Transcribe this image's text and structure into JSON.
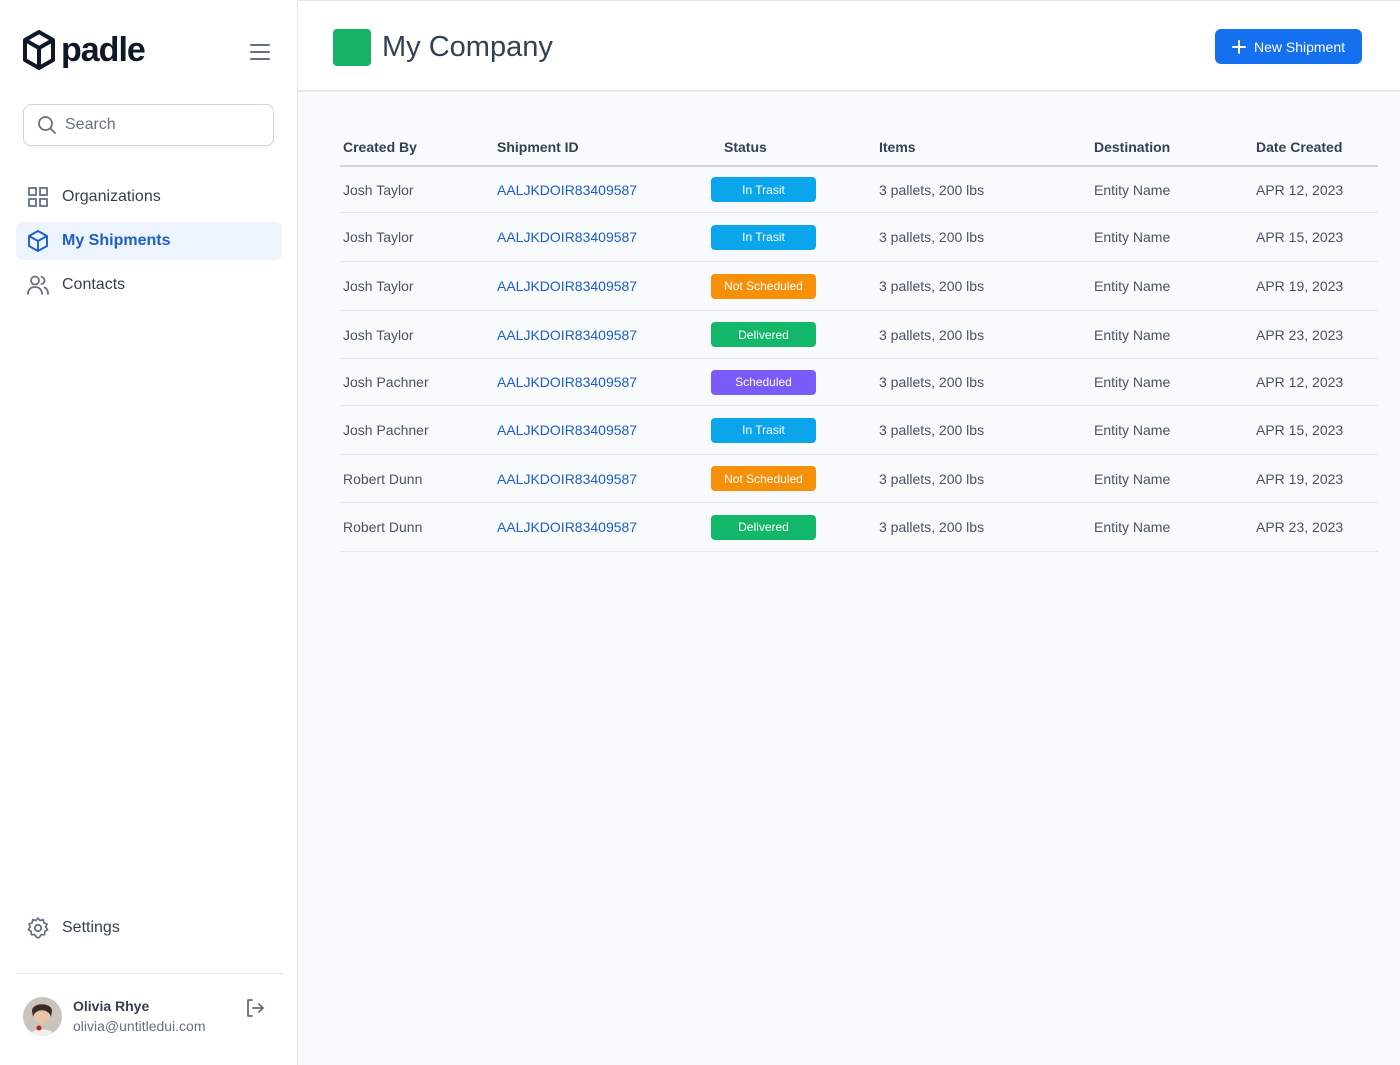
{
  "app": {
    "logo_text": "padle",
    "search_placeholder": "Search"
  },
  "sidebar": {
    "items": [
      {
        "label": "Organizations",
        "icon": "grid-icon",
        "active": false
      },
      {
        "label": "My Shipments",
        "icon": "cube-icon",
        "active": true
      },
      {
        "label": "Contacts",
        "icon": "users-icon",
        "active": false
      }
    ],
    "settings_label": "Settings"
  },
  "user": {
    "name": "Olivia Rhye",
    "email": "olivia@untitledui.com"
  },
  "header": {
    "title": "My Company",
    "new_button_label": "New Shipment"
  },
  "table": {
    "columns": [
      "Created By",
      "Shipment ID",
      "Status",
      "Items",
      "Destination",
      "Date Created"
    ],
    "rows": [
      {
        "created_by": "Josh Taylor",
        "shipment_id": "AALJKDOIR83409587",
        "status": "In Trasit",
        "items": "3 pallets, 200 lbs",
        "destination": "Entity Name",
        "date": "APR 12, 2023"
      },
      {
        "created_by": "Josh Taylor",
        "shipment_id": "AALJKDOIR83409587",
        "status": "In Trasit",
        "items": "3 pallets, 200 lbs",
        "destination": "Entity Name",
        "date": "APR 15, 2023"
      },
      {
        "created_by": "Josh Taylor",
        "shipment_id": "AALJKDOIR83409587",
        "status": "Not Scheduled",
        "items": "3 pallets, 200 lbs",
        "destination": "Entity Name",
        "date": "APR 19, 2023"
      },
      {
        "created_by": "Josh Taylor",
        "shipment_id": "AALJKDOIR83409587",
        "status": "Delivered",
        "items": "3 pallets, 200 lbs",
        "destination": "Entity Name",
        "date": "APR 23, 2023"
      },
      {
        "created_by": "Josh Pachner",
        "shipment_id": "AALJKDOIR83409587",
        "status": "Scheduled",
        "items": "3 pallets, 200 lbs",
        "destination": "Entity Name",
        "date": "APR 12, 2023"
      },
      {
        "created_by": "Josh Pachner",
        "shipment_id": "AALJKDOIR83409587",
        "status": "In Trasit",
        "items": "3 pallets, 200 lbs",
        "destination": "Entity Name",
        "date": "APR 15, 2023"
      },
      {
        "created_by": "Robert Dunn",
        "shipment_id": "AALJKDOIR83409587",
        "status": "Not Scheduled",
        "items": "3 pallets, 200 lbs",
        "destination": "Entity Name",
        "date": "APR 19, 2023"
      },
      {
        "created_by": "Robert Dunn",
        "shipment_id": "AALJKDOIR83409587",
        "status": "Delivered",
        "items": "3 pallets, 200 lbs",
        "destination": "Entity Name",
        "date": "APR 23, 2023"
      }
    ]
  },
  "colors": {
    "brand": "#1570ef",
    "company": "#16b364",
    "status": {
      "In Trasit": "#0ba5ec",
      "Not Scheduled": "#f79009",
      "Delivered": "#12b76a",
      "Scheduled": "#7a5af8"
    }
  }
}
